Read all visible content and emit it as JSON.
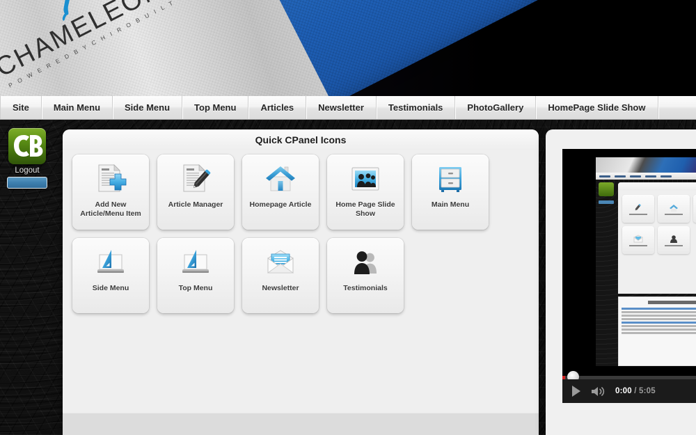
{
  "header": {
    "brand_name": "CHAMELEON",
    "brand_tagline": "P O W E R E D   B Y   C H I R O B U I L T",
    "logo_icon": "lizard-icon"
  },
  "nav": {
    "items": [
      {
        "label": "Site"
      },
      {
        "label": "Main Menu"
      },
      {
        "label": "Side Menu"
      },
      {
        "label": "Top Menu"
      },
      {
        "label": "Articles"
      },
      {
        "label": "Newsletter"
      },
      {
        "label": "Testimonials"
      },
      {
        "label": "PhotoGallery"
      },
      {
        "label": "HomePage Slide Show"
      }
    ]
  },
  "sidebar": {
    "logo_text": "CB",
    "logout_label": "Logout",
    "logout_button_label": ""
  },
  "main": {
    "panel_title": "Quick CPanel Icons",
    "rows": [
      [
        {
          "label": "Add New Article/Menu Item",
          "icon": "document-plus-icon"
        },
        {
          "label": "Article Manager",
          "icon": "document-pencil-icon"
        },
        {
          "label": "Homepage Article",
          "icon": "house-icon"
        },
        {
          "label": "Home Page Slide Show",
          "icon": "photo-people-icon"
        },
        {
          "label": "Main Menu",
          "icon": "filing-cabinet-icon"
        }
      ],
      [
        {
          "label": "Side Menu",
          "icon": "monitor-ruler-icon"
        },
        {
          "label": "Top Menu",
          "icon": "monitor-ruler-icon"
        },
        {
          "label": "Newsletter",
          "icon": "envelope-icon"
        },
        {
          "label": "Testimonials",
          "icon": "people-icon"
        }
      ]
    ]
  },
  "video": {
    "current_time": "0:00",
    "separator": " / ",
    "total_time": "5:05",
    "play_icon": "play-icon",
    "volume_icon": "volume-icon",
    "scrubber_icon": "scrubber-handle"
  },
  "colors": {
    "accent_blue": "#3d7fae",
    "brand_green": "#5c8f16",
    "panel_bg": "#efefef",
    "progress_red": "#cf2020"
  }
}
